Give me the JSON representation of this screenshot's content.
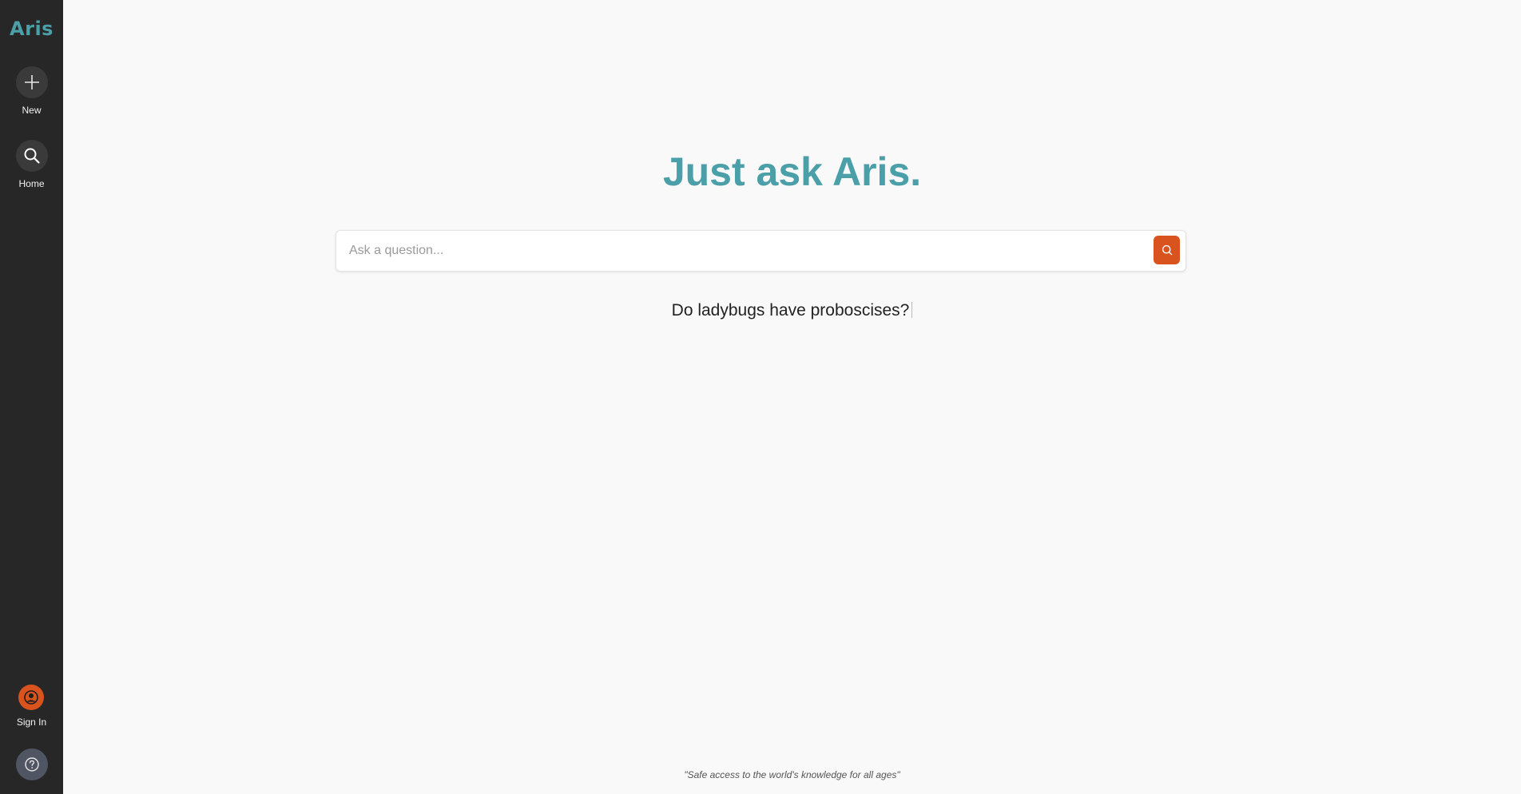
{
  "app": {
    "logo_text": "Aris"
  },
  "sidebar": {
    "items": [
      {
        "label": "New",
        "icon": "plus-icon"
      },
      {
        "label": "Home",
        "icon": "search-icon"
      }
    ],
    "sign_in": {
      "label": "Sign In",
      "icon": "user-icon"
    },
    "help": {
      "icon": "help-icon"
    }
  },
  "main": {
    "title": "Just ask Aris.",
    "search": {
      "placeholder": "Ask a question...",
      "value": "",
      "button_icon": "search-icon"
    },
    "suggestion": "Do ladybugs have proboscises?",
    "tagline": "\"Safe access to the world's knowledge for all ages\""
  },
  "colors": {
    "accent": "#4a9fa8",
    "brand_orange": "#d9531e",
    "sidebar_bg": "#272727",
    "page_bg": "#f9f9f9"
  }
}
